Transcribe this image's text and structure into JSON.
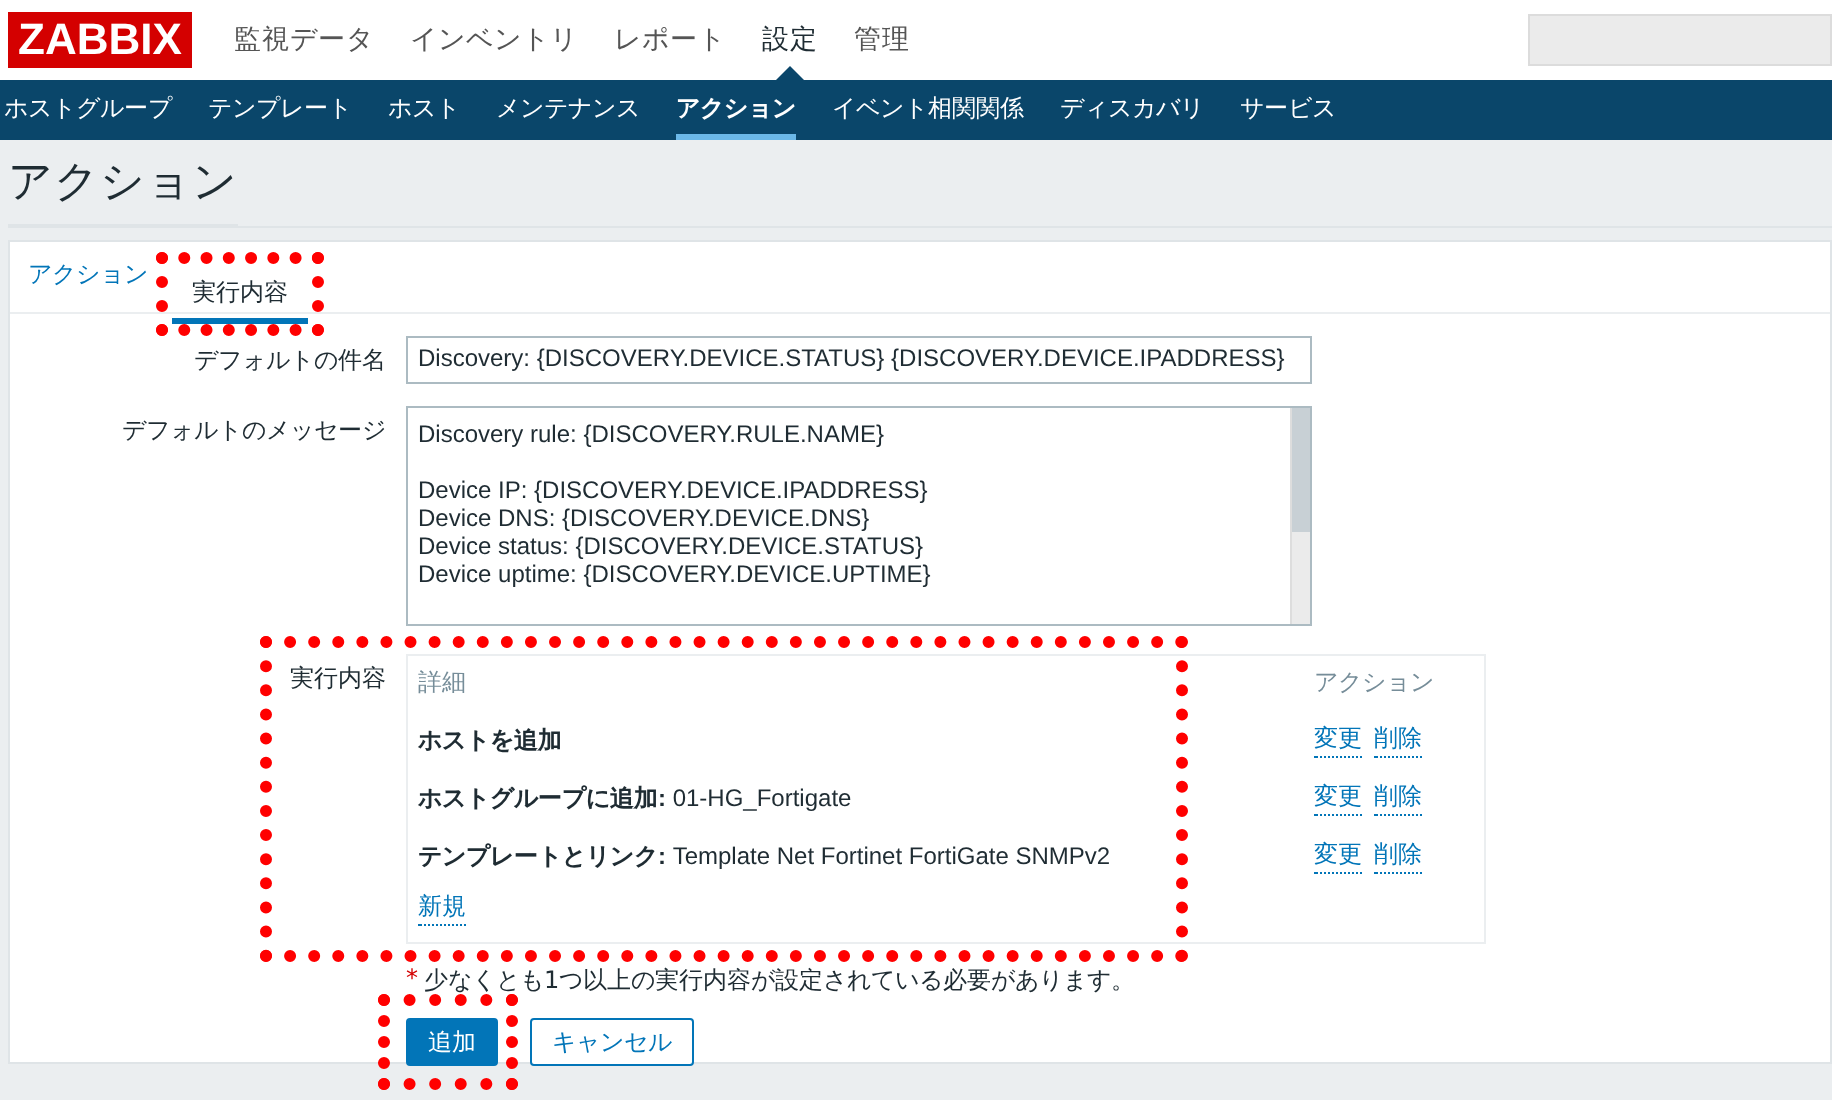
{
  "header": {
    "logo": "ZABBIX",
    "menu": [
      {
        "label": "監視データ",
        "selected": false
      },
      {
        "label": "インベントリ",
        "selected": false
      },
      {
        "label": "レポート",
        "selected": false
      },
      {
        "label": "設定",
        "selected": true
      },
      {
        "label": "管理",
        "selected": false
      }
    ]
  },
  "submenu": [
    {
      "label": "ホストグループ",
      "selected": false
    },
    {
      "label": "テンプレート",
      "selected": false
    },
    {
      "label": "ホスト",
      "selected": false
    },
    {
      "label": "メンテナンス",
      "selected": false
    },
    {
      "label": "アクション",
      "selected": true
    },
    {
      "label": "イベント相関関係",
      "selected": false
    },
    {
      "label": "ディスカバリ",
      "selected": false
    },
    {
      "label": "サービス",
      "selected": false
    }
  ],
  "page_title": "アクション",
  "tabs": [
    {
      "label": "アクション",
      "selected": false,
      "highlighted": false
    },
    {
      "label": "実行内容",
      "selected": true,
      "highlighted": true
    }
  ],
  "form": {
    "subject": {
      "label": "デフォルトの件名",
      "value": "Discovery: {DISCOVERY.DEVICE.STATUS} {DISCOVERY.DEVICE.IPADDRESS}"
    },
    "message": {
      "label": "デフォルトのメッセージ",
      "paragraphs": [
        [
          "Discovery rule: {DISCOVERY.RULE.NAME}"
        ],
        [
          "Device IP: {DISCOVERY.DEVICE.IPADDRESS}",
          "Device DNS: {DISCOVERY.DEVICE.DNS}",
          "Device status: {DISCOVERY.DEVICE.STATUS}",
          "Device uptime: {DISCOVERY.DEVICE.UPTIME}"
        ]
      ]
    },
    "operations": {
      "label": "実行内容",
      "highlighted": true,
      "columns": [
        "詳細",
        "アクション"
      ],
      "rows": [
        {
          "detail": "ホストを追加",
          "actions": [
            "変更",
            "削除"
          ]
        },
        {
          "detail": "ホストグループに追加:",
          "value": "01-HG_Fortigate",
          "actions": [
            "変更",
            "削除"
          ]
        },
        {
          "detail": "テンプレートとリンク:",
          "value": "Template Net Fortinet FortiGate SNMPv2",
          "actions": [
            "変更",
            "削除"
          ]
        }
      ],
      "new_link": "新規"
    },
    "note_mark": "*",
    "note": "少なくとも1つ以上の実行内容が設定されている必要があります。",
    "buttons": [
      {
        "label": "追加",
        "kind": "primary",
        "highlighted": true
      },
      {
        "label": "キャンセル",
        "kind": "secondary",
        "highlighted": false
      }
    ]
  }
}
